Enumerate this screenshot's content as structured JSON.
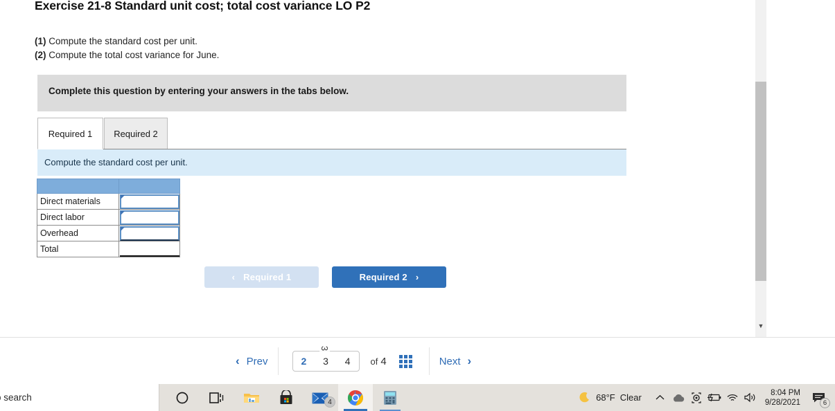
{
  "exercise": {
    "title": "Exercise 21-8 Standard unit cost; total cost variance LO P2",
    "requirement_1_num": "(1)",
    "requirement_1_text": "Compute the standard cost per unit.",
    "requirement_2_num": "(2)",
    "requirement_2_text": "Compute the total cost variance for June.",
    "instruction_banner": "Complete this question by entering your answers in the tabs below."
  },
  "tabs": [
    {
      "label": "Required 1",
      "active": true
    },
    {
      "label": "Required 2",
      "active": false
    }
  ],
  "tab_prompt": "Compute the standard cost per unit.",
  "answer_table": {
    "header_label": "",
    "header_value": "",
    "rows": [
      {
        "label": "Direct materials",
        "value": "",
        "type": "input"
      },
      {
        "label": "Direct labor",
        "value": "",
        "type": "input"
      },
      {
        "label": "Overhead",
        "value": "",
        "type": "input"
      },
      {
        "label": "Total",
        "value": "",
        "type": "total"
      }
    ]
  },
  "nav_buttons": {
    "prev": {
      "label": "Required 1",
      "chevron": "‹",
      "disabled": true
    },
    "next": {
      "label": "Required 2",
      "chevron": "›",
      "disabled": false
    }
  },
  "pagination": {
    "prev_label": "Prev",
    "prev_chevron": "‹",
    "next_label": "Next",
    "next_chevron": "›",
    "numbers": [
      "2",
      "3",
      "4"
    ],
    "current": "2",
    "ghost_number": "3",
    "of_label": "of",
    "total_pages": "4",
    "grid_icon": "grid-view-icon"
  },
  "scrollbar": {
    "down_arrow": "▼"
  },
  "taskbar": {
    "search_placeholder": "o search",
    "icons": [
      {
        "name": "cortana-icon",
        "glyph": "O"
      },
      {
        "name": "task-view-icon",
        "glyph": ""
      },
      {
        "name": "file-explorer-icon",
        "glyph": ""
      },
      {
        "name": "microsoft-store-icon",
        "glyph": ""
      },
      {
        "name": "mail-icon",
        "glyph": "",
        "badge": "4"
      },
      {
        "name": "google-chrome-icon",
        "glyph": "",
        "active": true
      },
      {
        "name": "calculator-icon",
        "glyph": ""
      }
    ],
    "tray": {
      "weather_icon": "moon-icon",
      "temperature": "68°F",
      "condition": "Clear",
      "show_hidden_icon": "∧",
      "onedrive_icon": "cloud-icon",
      "camera_icon": "webcam-icon",
      "battery_icon": "battery-icon",
      "network_icon": "wifi-icon",
      "volume_icon": "speaker-icon",
      "time": "8:04 PM",
      "date": "9/28/2021",
      "notification_icon": "notification-icon",
      "notification_count": "6"
    }
  },
  "colors": {
    "accent_blue": "#3071b9",
    "table_header_blue": "#7eaddb",
    "prompt_bar_blue": "#d9ecf9",
    "banner_gray": "#dcdcdc",
    "input_border": "#5b8fc4"
  }
}
